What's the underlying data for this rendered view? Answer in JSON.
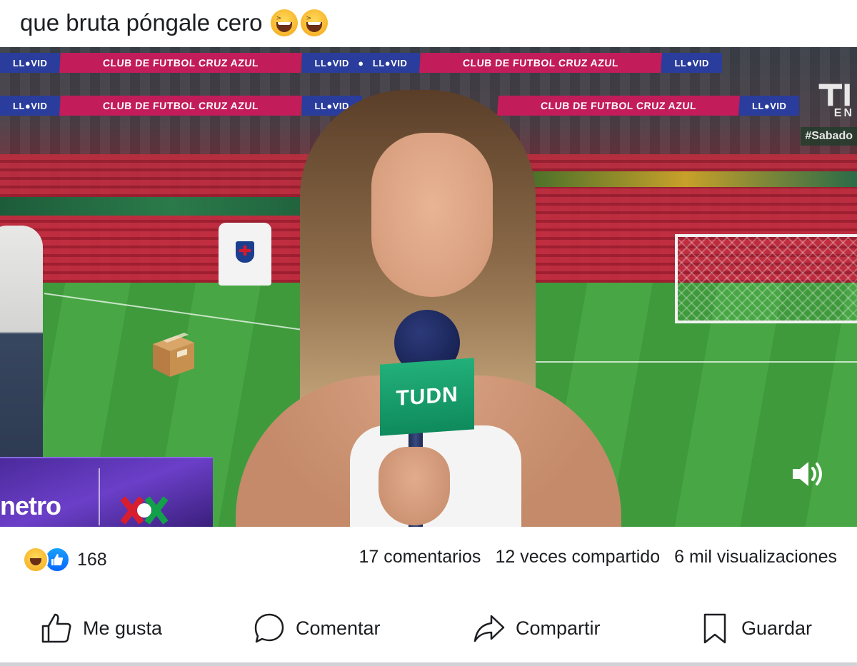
{
  "post": {
    "caption": "que bruta póngale cero",
    "caption_emojis": [
      "grinning-squinting-face",
      "grinning-squinting-face"
    ]
  },
  "video": {
    "banner_text_1": "CLUB DE FUTBOL CRUZ AZUL",
    "banner_text_2": "CLUB DE FUTBOL CRUZ AZUL",
    "banner_text_3": "CLUB DE FUTBOL CRUZ AZUL",
    "banner_text_4": "CLUB DE FUTBOL CRUZ AZUL",
    "mic_flag_text": "TUDN",
    "corner_logo_text": "EN",
    "hashtag": "#Sabado",
    "ticker_brand": "netro",
    "box_emoji": "package",
    "volume_icon": "speaker-on-icon",
    "colors": {
      "banner_pink": "#c21c5a",
      "banner_blue": "#2a3d9c",
      "ticker_purple": "#6b3fc8",
      "mic_green": "#12a06c"
    }
  },
  "stats": {
    "reaction_icons": [
      "haha",
      "like"
    ],
    "reaction_count": "168",
    "comments": "17 comentarios",
    "shares": "12 veces compartido",
    "views": "6 mil visualizaciones"
  },
  "actions": {
    "like_label": "Me gusta",
    "comment_label": "Comentar",
    "share_label": "Compartir",
    "save_label": "Guardar"
  }
}
